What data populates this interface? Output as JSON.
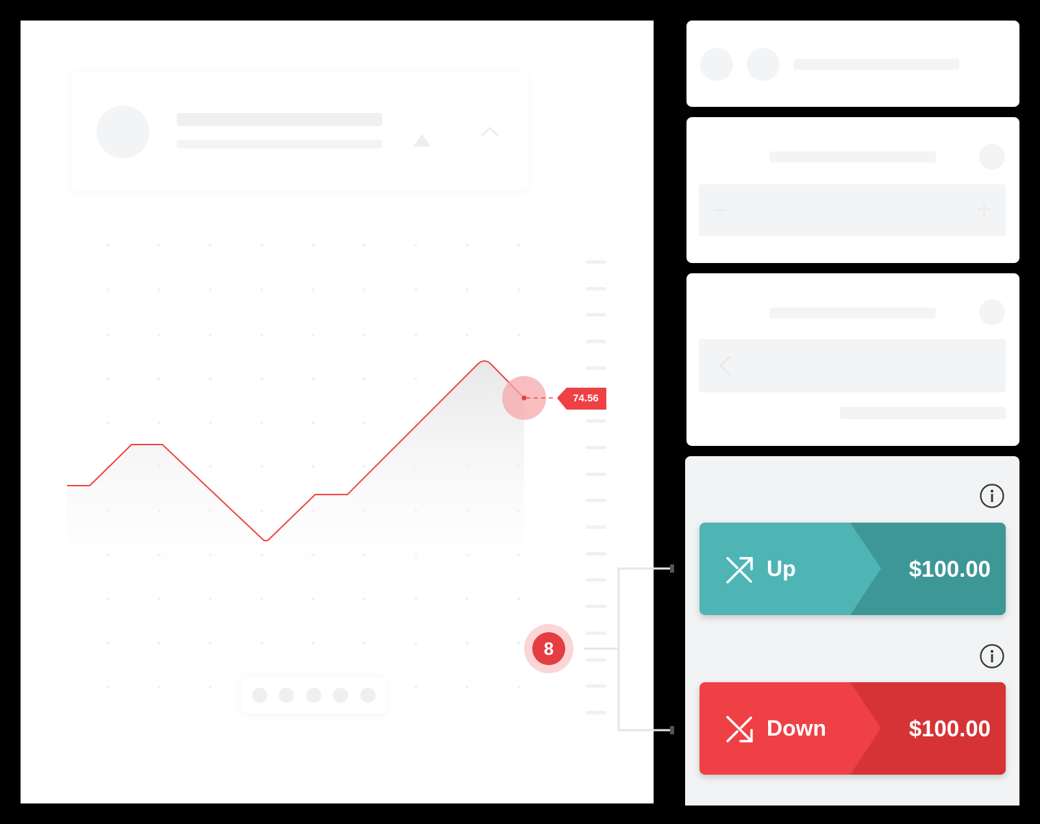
{
  "chart_data": {
    "type": "line",
    "title": "",
    "xlabel": "",
    "ylabel": "",
    "current_price": "74.56",
    "series": [
      {
        "color": "#ef4444"
      }
    ]
  },
  "annotation": {
    "number": "8"
  },
  "trade": {
    "up": {
      "label": "Up",
      "amount": "$100.00",
      "color_light": "#4fb4b4",
      "color_dark": "#3e9797"
    },
    "down": {
      "label": "Down",
      "amount": "$100.00",
      "color_light": "#ef4045",
      "color_dark": "#d63336"
    }
  },
  "icons": [
    "info-icon",
    "arrow-up-right-icon",
    "arrow-down-right-icon",
    "minus-icon",
    "plus-icon",
    "chevron-left-icon",
    "triangle-up-icon",
    "chevron-up-icon"
  ]
}
